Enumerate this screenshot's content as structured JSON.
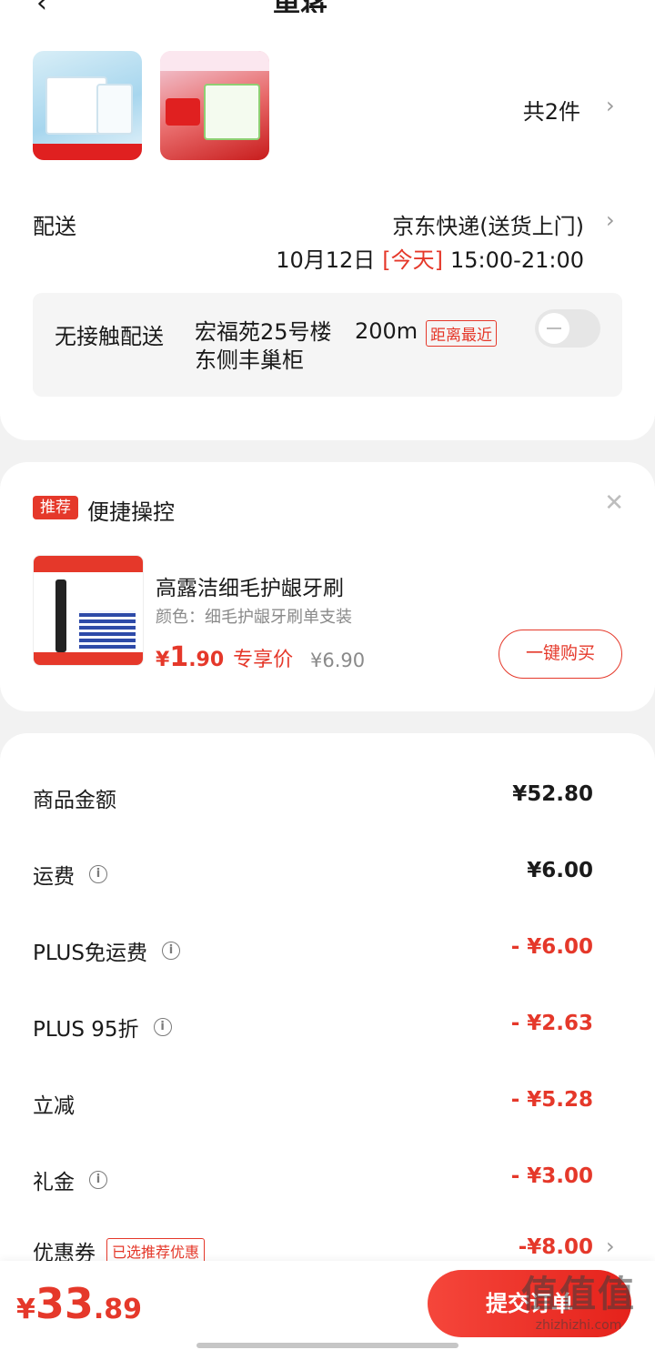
{
  "header": {
    "back_icon": "chevron-left-icon",
    "title": "单将"
  },
  "order_items": {
    "count_label": "共2件",
    "thumbnails": [
      {
        "name": "milk-gift-box-thumbnail",
        "accent": "#a7d6ee"
      },
      {
        "name": "milk-pack-thumbnail",
        "accent": "#e02020"
      }
    ]
  },
  "shipping": {
    "label": "配送",
    "method": "京东快递(送货上门)",
    "date": "10月12日",
    "today": "[今天]",
    "time_window": "15:00-21:00"
  },
  "contactless": {
    "label": "无接触配送",
    "address_line1": "宏福苑25号楼",
    "distance": "200m",
    "nearest_tag": "距离最近",
    "address_line2": "东侧丰巢柜",
    "toggle_on": false
  },
  "recommendation": {
    "badge": "推荐",
    "title": "便捷操控",
    "product_name": "高露洁细毛护龈牙刷",
    "spec": "颜色：细毛护龈牙刷单支装",
    "price_currency": "¥",
    "price_int": "1",
    "price_dec": ".90",
    "price_tag": "专享价",
    "original_price": "¥6.90",
    "buy_button": "一键购买"
  },
  "summary": {
    "rows": [
      {
        "label": "商品金额",
        "value": "¥52.80",
        "info": false,
        "highlight": false
      },
      {
        "label": "运费",
        "value": "¥6.00",
        "info": true,
        "highlight": false
      },
      {
        "label": "PLUS免运费",
        "value": "- ¥6.00",
        "info": true,
        "highlight": true
      },
      {
        "label": "PLUS 95折",
        "value": "- ¥2.63",
        "info": true,
        "highlight": true
      },
      {
        "label": "立减",
        "value": "- ¥5.28",
        "info": false,
        "highlight": true
      },
      {
        "label": "礼金",
        "value": "- ¥3.00",
        "info": true,
        "highlight": true
      }
    ],
    "coupon": {
      "label": "优惠券",
      "tag": "已选推荐优惠",
      "value": "-¥8.00"
    }
  },
  "footer": {
    "total_currency": "¥",
    "total_int": "33",
    "total_dec": ".89",
    "submit_label": "提交订单"
  },
  "watermark": {
    "main": "值值值",
    "sub": "zhizhizhi.com"
  },
  "colors": {
    "accent": "#e5382a",
    "background": "#f2f2f2"
  }
}
